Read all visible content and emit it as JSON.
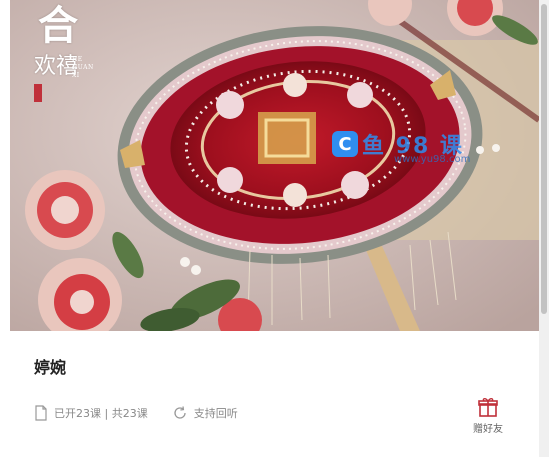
{
  "hero": {
    "brand_big": "合",
    "brand_mid": "欢禧",
    "brand_pinyin": "HE HUAN XI",
    "watermark_text": "鱼 98 课",
    "watermark_url": "www.yu98.com",
    "icons": {
      "watermark_logo": "c-logo-icon"
    }
  },
  "course": {
    "title": "婷婉",
    "lessons": "已开23课 | 共23课",
    "replay": "支持回听"
  },
  "actions": {
    "gift_label": "赠好友"
  },
  "colors": {
    "accent": "#c0303a",
    "watermark_blue": "#2f8ef0",
    "meta_text": "#888888",
    "title_text": "#222222"
  },
  "icons": {
    "lessons": "document-icon",
    "replay": "replay-icon",
    "gift": "gift-box-icon"
  }
}
